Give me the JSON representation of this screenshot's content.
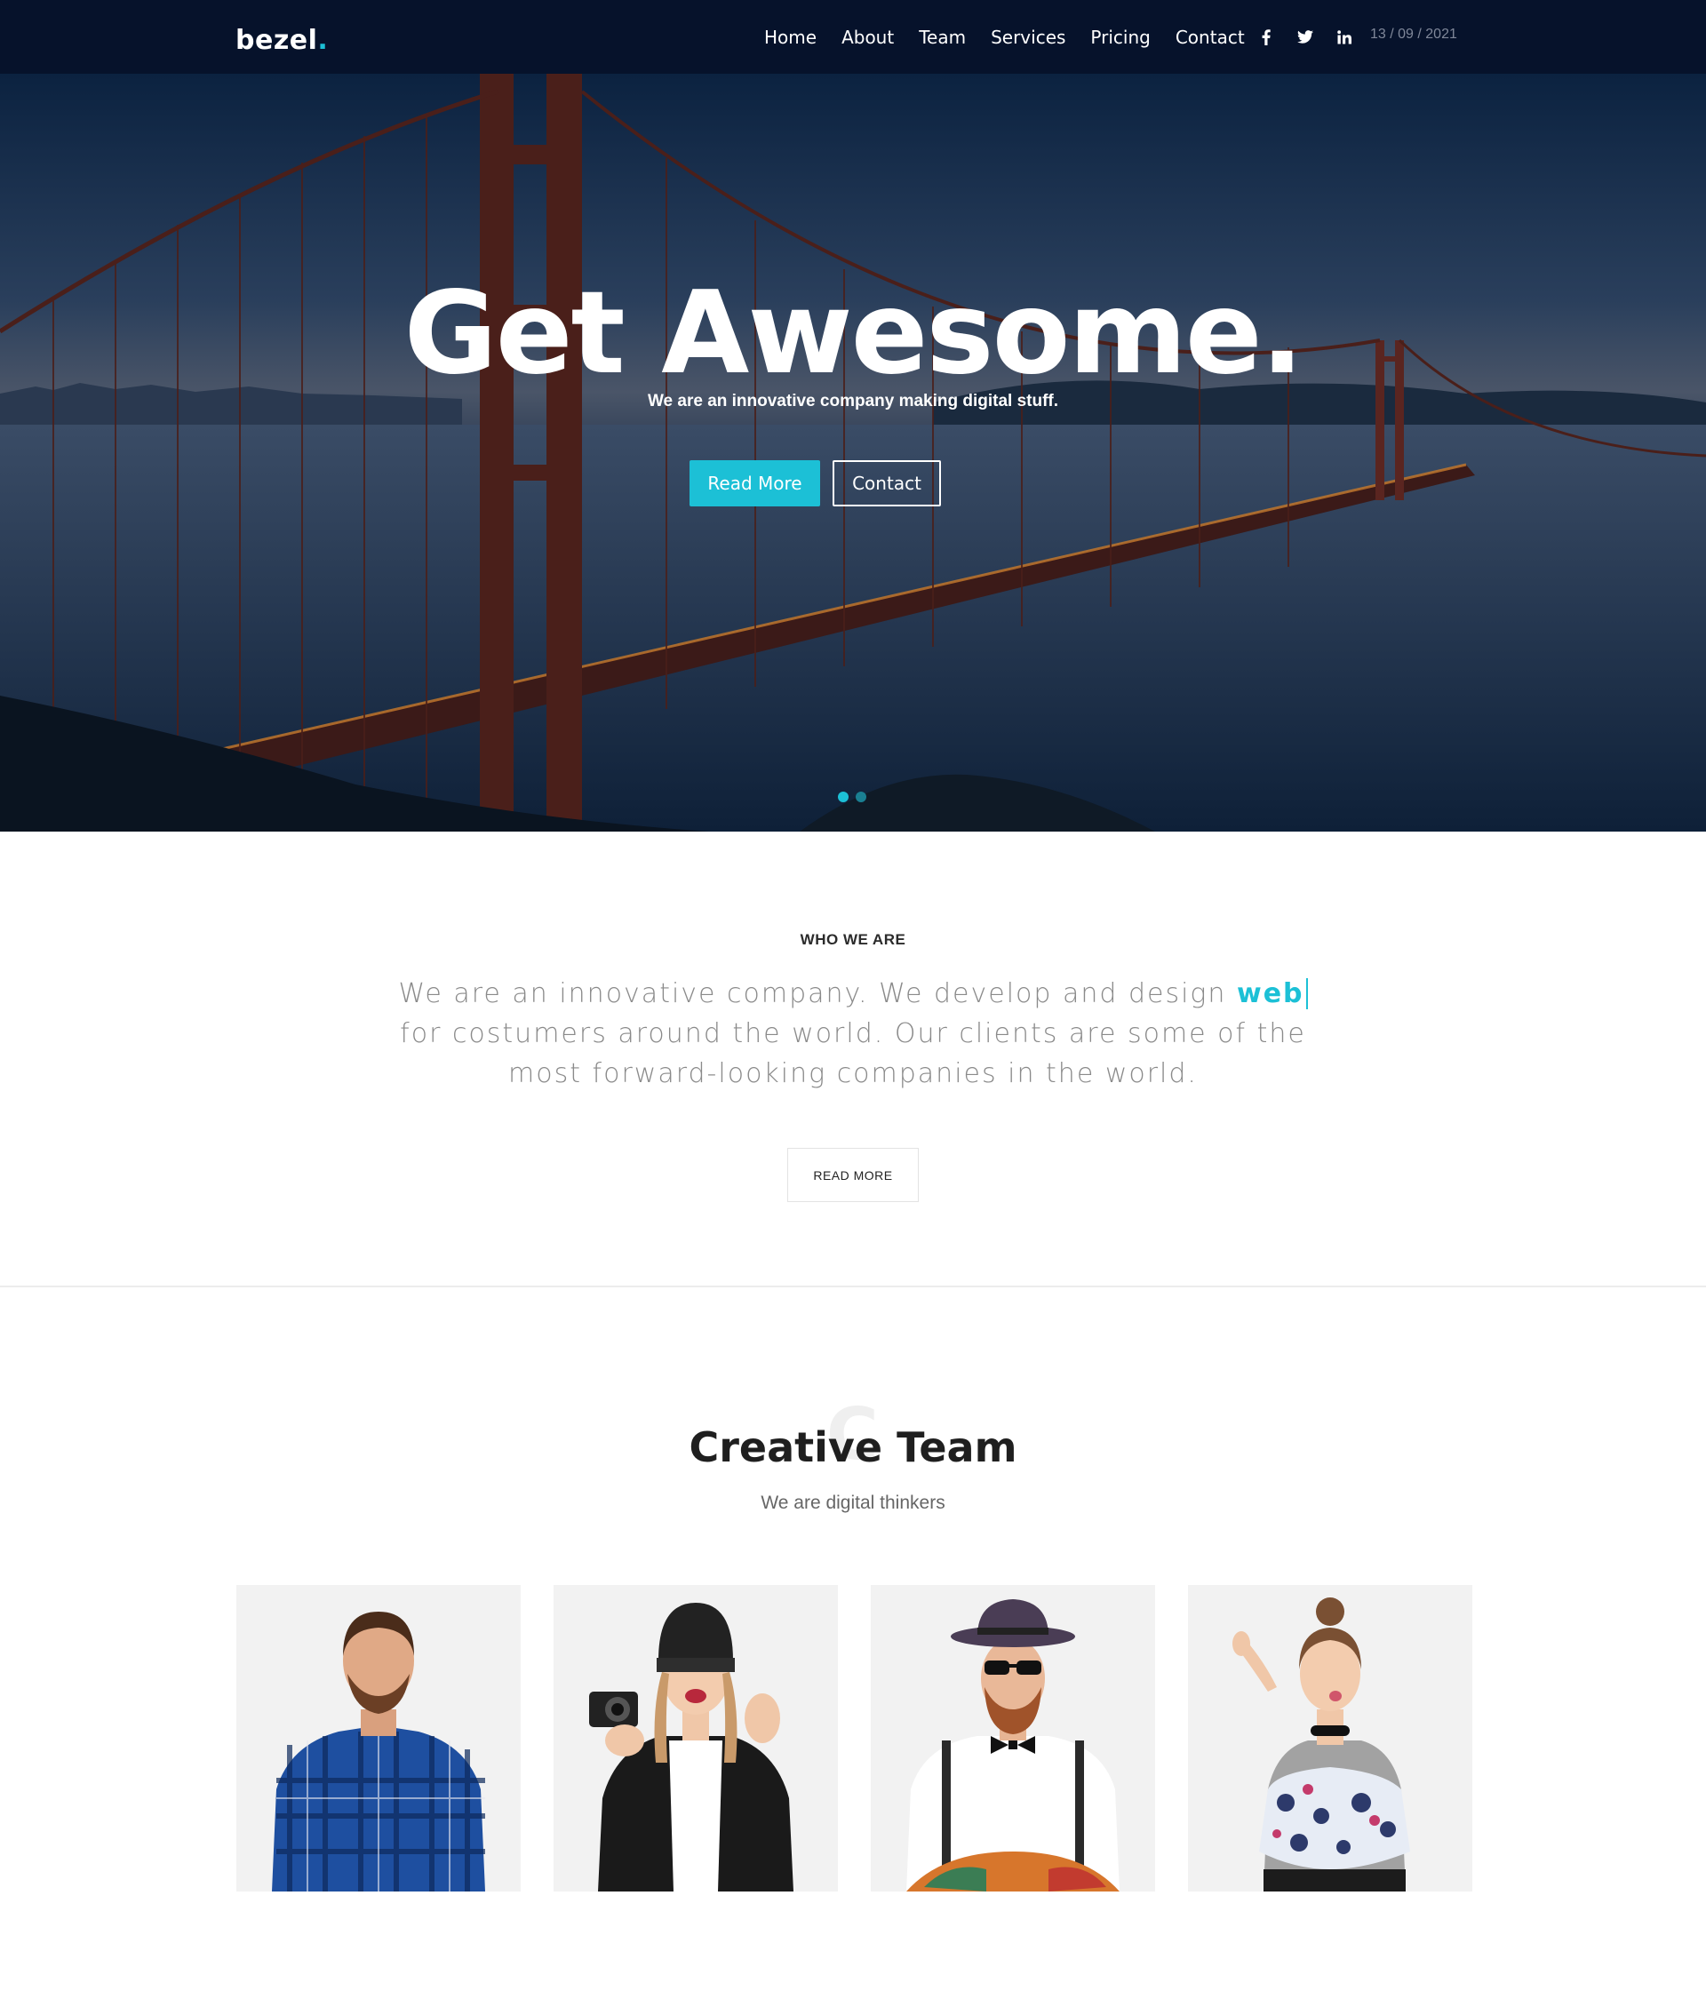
{
  "nav": {
    "logo": "bezel",
    "logo_dot": ".",
    "links": [
      "Home",
      "About",
      "Team",
      "Services",
      "Pricing",
      "Contact"
    ],
    "socials": [
      "facebook-icon",
      "twitter-icon",
      "linkedin-icon"
    ],
    "date": "13 / 09 / 2021"
  },
  "hero": {
    "title": "Get Awesome.",
    "subtitle": "We are an innovative company making digital stuff.",
    "primary_button": "Read More",
    "secondary_button": "Contact",
    "slides_count": 2,
    "active_slide": 1
  },
  "who": {
    "label": "WHO WE ARE",
    "text_before": "We are an innovative company. We develop and design ",
    "highlight": "web",
    "text_after": " for costumers around the world. Our clients are some of the most forward-looking companies in the world.",
    "button": "READ MORE"
  },
  "team": {
    "watermark": "C",
    "title": "Creative Team",
    "subtitle": "We are digital thinkers",
    "members": [
      "member-plaid-shirt",
      "member-beanie-camera",
      "member-hat-sunglasses",
      "member-floral-top"
    ]
  },
  "colors": {
    "accent": "#1cc0d6",
    "nav_bg": "#06122b",
    "text_gray": "#8a8a8a"
  }
}
